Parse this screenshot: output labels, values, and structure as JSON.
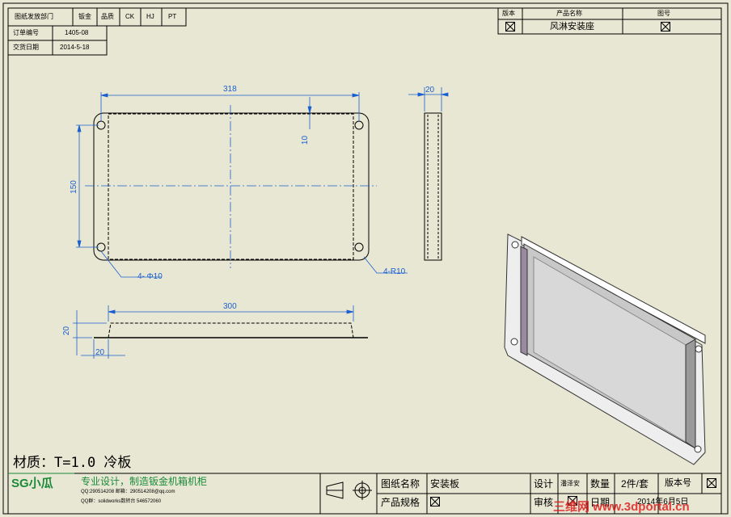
{
  "top_left_table": {
    "row1": [
      "图纸发放部门",
      "钣金",
      "品质",
      "CK",
      "HJ",
      "PT"
    ],
    "order_label": "订单编号",
    "order_value": "1405-08",
    "date_label": "交货日期",
    "date_value": "2014-5-18"
  },
  "top_right_table": {
    "h_version": "版本",
    "h_product": "产品名称",
    "h_drawing_no": "图号",
    "product_name": "风淋安装座"
  },
  "dimensions": {
    "top_width": "318",
    "hole_offset": "10",
    "height": "150",
    "hole_dia": "4- Φ10",
    "radius": "4-R10",
    "side_depth": "20",
    "bottom_width": "300",
    "bottom_height": "20",
    "bottom_offset": "20"
  },
  "material": "材质：T=1.0 冷板",
  "title_block": {
    "logo": "SG小瓜",
    "slogan": "专业设计，制造钣金机箱机柜",
    "qq_line": "QQ:290514208 邮箱：290514208@qq.com",
    "group_line": "QQ群：solidworks数转台 546572060",
    "drawing_name_label": "图纸名称",
    "drawing_name": "安装板",
    "spec_label": "产品规格",
    "design_label": "设计",
    "designer": "潘泽安",
    "qty_label": "数量",
    "qty_value": "2件/套",
    "version_label": "版本号",
    "review_label": "审核",
    "date_label": "日期",
    "date_value": "2014年6月5日"
  },
  "watermark": "三维网 www.3dportal.cn",
  "colors": {
    "dimension": "#1a5fd0",
    "background": "#e8e7d3",
    "watermark": "#e02020"
  }
}
